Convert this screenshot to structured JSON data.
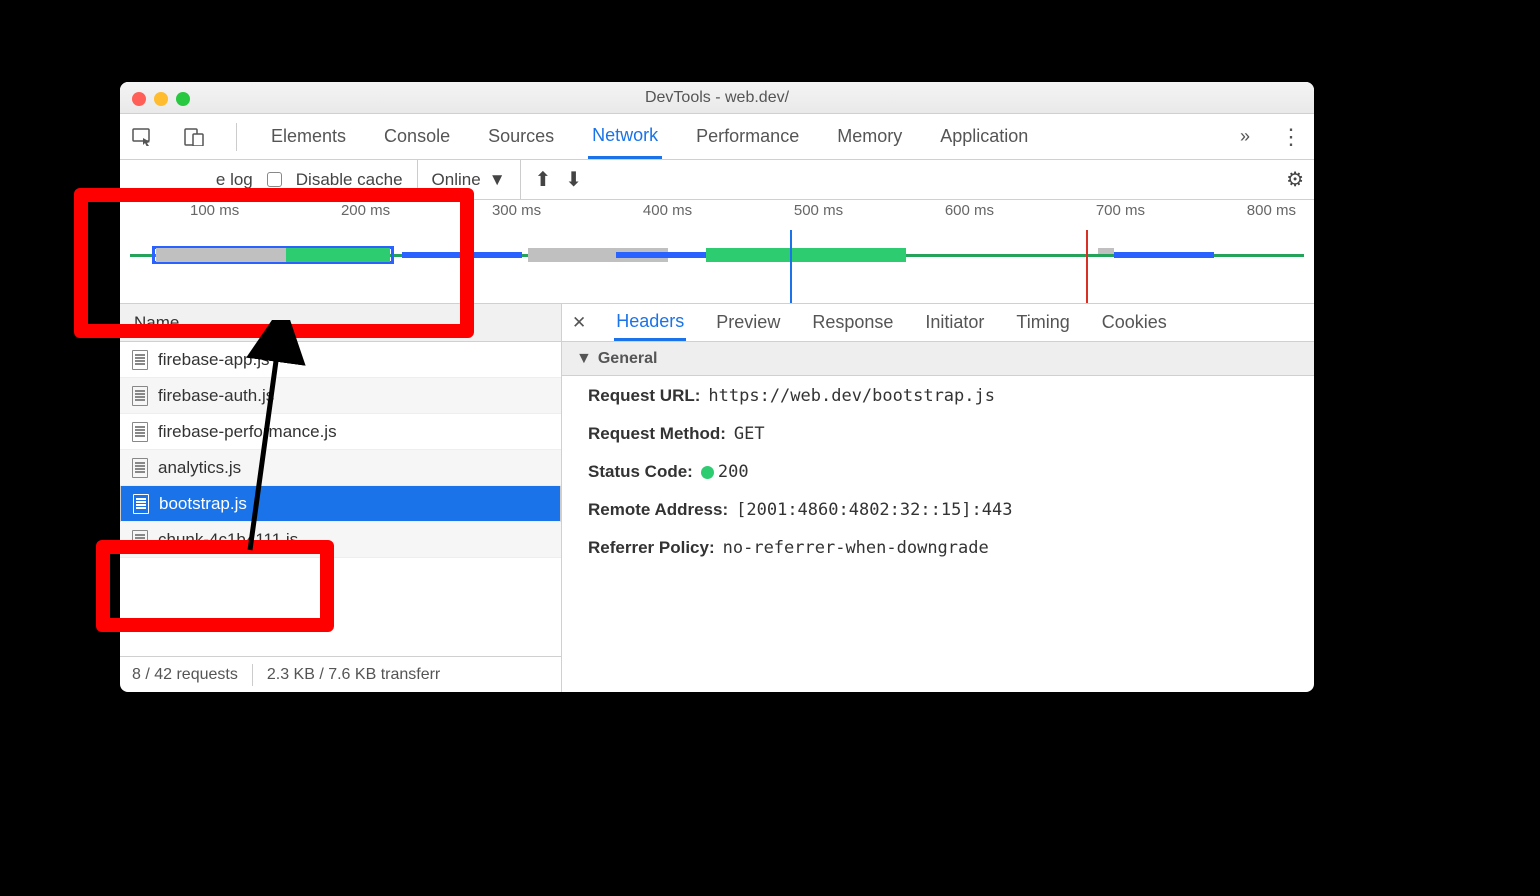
{
  "window": {
    "title": "DevTools - web.dev/"
  },
  "main_tabs": [
    "Elements",
    "Console",
    "Sources",
    "Network",
    "Performance",
    "Memory",
    "Application"
  ],
  "main_tab_active": "Network",
  "toolbar": {
    "preserve_log": "e log",
    "disable_cache": "Disable cache",
    "throttle": "Online"
  },
  "overview": {
    "ticks": [
      "100 ms",
      "200 ms",
      "300 ms",
      "400 ms",
      "500 ms",
      "600 ms",
      "700 ms",
      "800 ms"
    ]
  },
  "name_header": "Name",
  "requests": [
    {
      "name": "firebase-app.js",
      "selected": false
    },
    {
      "name": "firebase-auth.js",
      "selected": false
    },
    {
      "name": "firebase-performance.js",
      "selected": false
    },
    {
      "name": "analytics.js",
      "selected": false
    },
    {
      "name": "bootstrap.js",
      "selected": true
    },
    {
      "name": "chunk-4c1b4111.js",
      "selected": false
    }
  ],
  "status": {
    "requests": "8 / 42 requests",
    "transfer": "2.3 KB / 7.6 KB transferr"
  },
  "detail_tabs": [
    "Headers",
    "Preview",
    "Response",
    "Initiator",
    "Timing",
    "Cookies"
  ],
  "detail_tab_active": "Headers",
  "section": "General",
  "kv": {
    "url_k": "Request URL:",
    "url_v": "https://web.dev/bootstrap.js",
    "method_k": "Request Method:",
    "method_v": "GET",
    "status_k": "Status Code:",
    "status_v": "200",
    "remote_k": "Remote Address:",
    "remote_v": "[2001:4860:4802:32::15]:443",
    "ref_k": "Referrer Policy:",
    "ref_v": "no-referrer-when-downgrade"
  }
}
